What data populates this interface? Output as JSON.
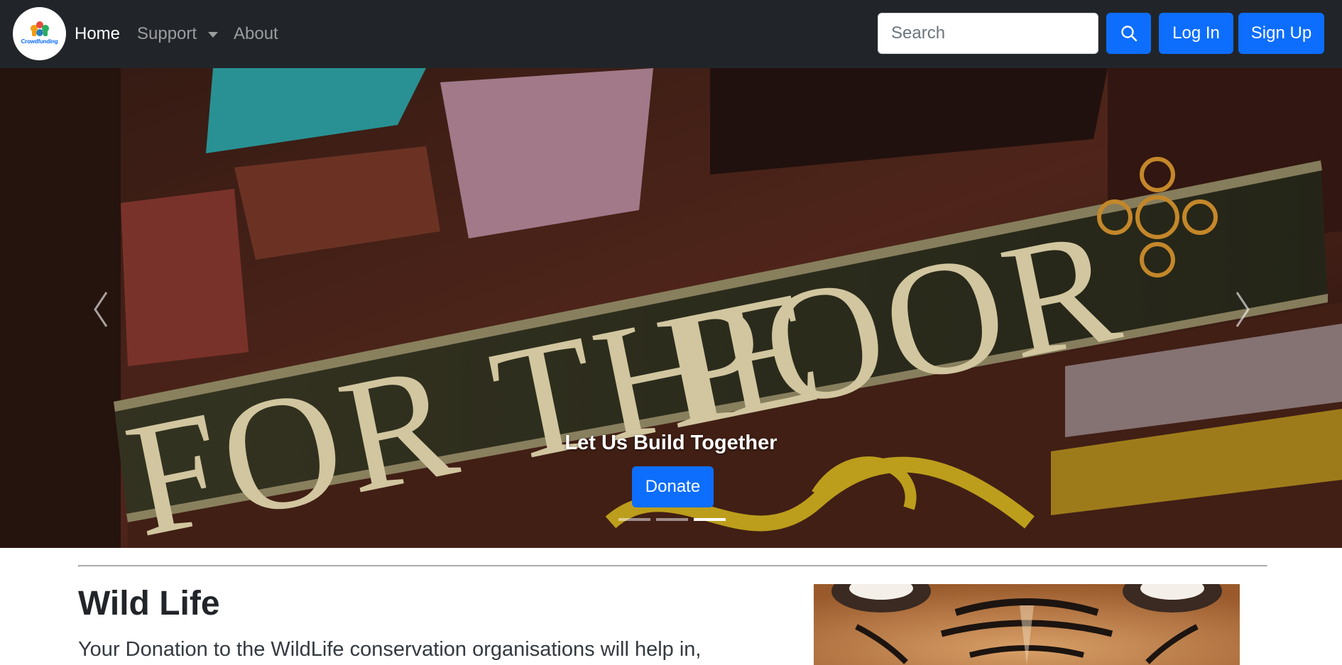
{
  "navbar": {
    "brand_text": "Crowdfunding",
    "links": {
      "home": "Home",
      "support": "Support",
      "about": "About"
    },
    "search_placeholder": "Search",
    "login_label": "Log In",
    "signup_label": "Sign Up"
  },
  "carousel": {
    "caption_title": "Let Us Build Together",
    "donate_label": "Donate",
    "slide_count": 3,
    "active_slide": 3,
    "image_text": "FOR THE POOR"
  },
  "section": {
    "title": "Wild Life",
    "lead": "Your Donation to the WildLife conservation organisations will help in,"
  },
  "colors": {
    "navbar_bg": "#212529",
    "primary": "#0d6efd",
    "text": "#212529"
  },
  "icons": [
    "search-icon",
    "chevron-left-icon",
    "chevron-right-icon",
    "caret-down-icon"
  ]
}
